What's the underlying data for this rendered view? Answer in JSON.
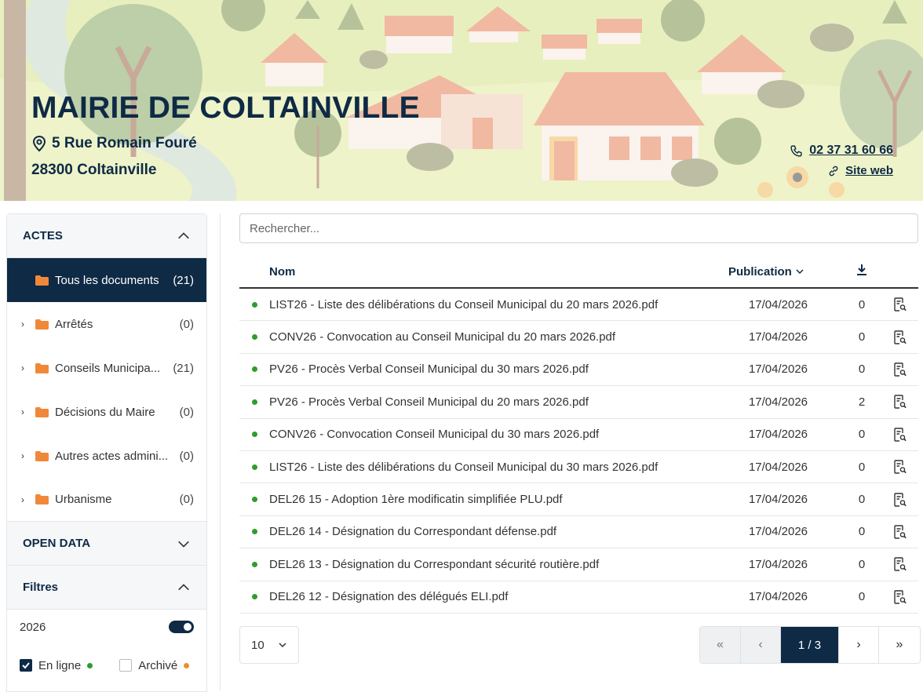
{
  "header": {
    "title": "MAIRIE DE COLTAINVILLE",
    "address_line1": "5 Rue Romain Fouré",
    "address_line2": "28300 Coltainville",
    "phone": "02 37 31 60 66",
    "website_label": "Site web"
  },
  "sidebar": {
    "actes_title": "ACTES",
    "items": [
      {
        "label": "Tous les documents",
        "count": "(21)"
      },
      {
        "label": "Arrêtés",
        "count": "(0)"
      },
      {
        "label": "Conseils Municipa...",
        "count": "(21)"
      },
      {
        "label": "Décisions du Maire",
        "count": "(0)"
      },
      {
        "label": "Autres actes admini...",
        "count": "(0)"
      },
      {
        "label": "Urbanisme",
        "count": "(0)"
      }
    ],
    "open_data_title": "OPEN DATA",
    "filters_title": "Filtres",
    "year": "2026",
    "online_label": "En ligne",
    "archived_label": "Archivé"
  },
  "search": {
    "placeholder": "Rechercher..."
  },
  "table": {
    "col_name": "Nom",
    "col_publication": "Publication",
    "rows": [
      {
        "name": "LIST26 - Liste des délibérations du Conseil Municipal du 20 mars 2026.pdf",
        "date": "17/04/2026",
        "downloads": "0"
      },
      {
        "name": "CONV26 - Convocation au Conseil Municipal du 20 mars 2026.pdf",
        "date": "17/04/2026",
        "downloads": "0"
      },
      {
        "name": "PV26 - Procès Verbal Conseil Municipal du 30 mars 2026.pdf",
        "date": "17/04/2026",
        "downloads": "0"
      },
      {
        "name": "PV26 - Procès Verbal Conseil Municipal du 20 mars 2026.pdf",
        "date": "17/04/2026",
        "downloads": "2"
      },
      {
        "name": "CONV26 - Convocation Conseil Municipal du 30 mars 2026.pdf",
        "date": "17/04/2026",
        "downloads": "0"
      },
      {
        "name": "LIST26 - Liste des délibérations du Conseil Municipal du 30 mars 2026.pdf",
        "date": "17/04/2026",
        "downloads": "0"
      },
      {
        "name": "DEL26 15 - Adoption 1ère modificatin simplifiée PLU.pdf",
        "date": "17/04/2026",
        "downloads": "0"
      },
      {
        "name": "DEL26 14 - Désignation du Correspondant défense.pdf",
        "date": "17/04/2026",
        "downloads": "0"
      },
      {
        "name": "DEL26 13 - Désignation du Correspondant sécurité routière.pdf",
        "date": "17/04/2026",
        "downloads": "0"
      },
      {
        "name": "DEL26 12 - Désignation des délégués ELI.pdf",
        "date": "17/04/2026",
        "downloads": "0"
      }
    ]
  },
  "pagination": {
    "page_size": "10",
    "first": "«",
    "prev": "‹",
    "current": "1 / 3",
    "next": "›",
    "last": "»"
  },
  "colors": {
    "primary": "#0e2a45",
    "online": "#2e9c2e",
    "archived": "#e8922b"
  }
}
